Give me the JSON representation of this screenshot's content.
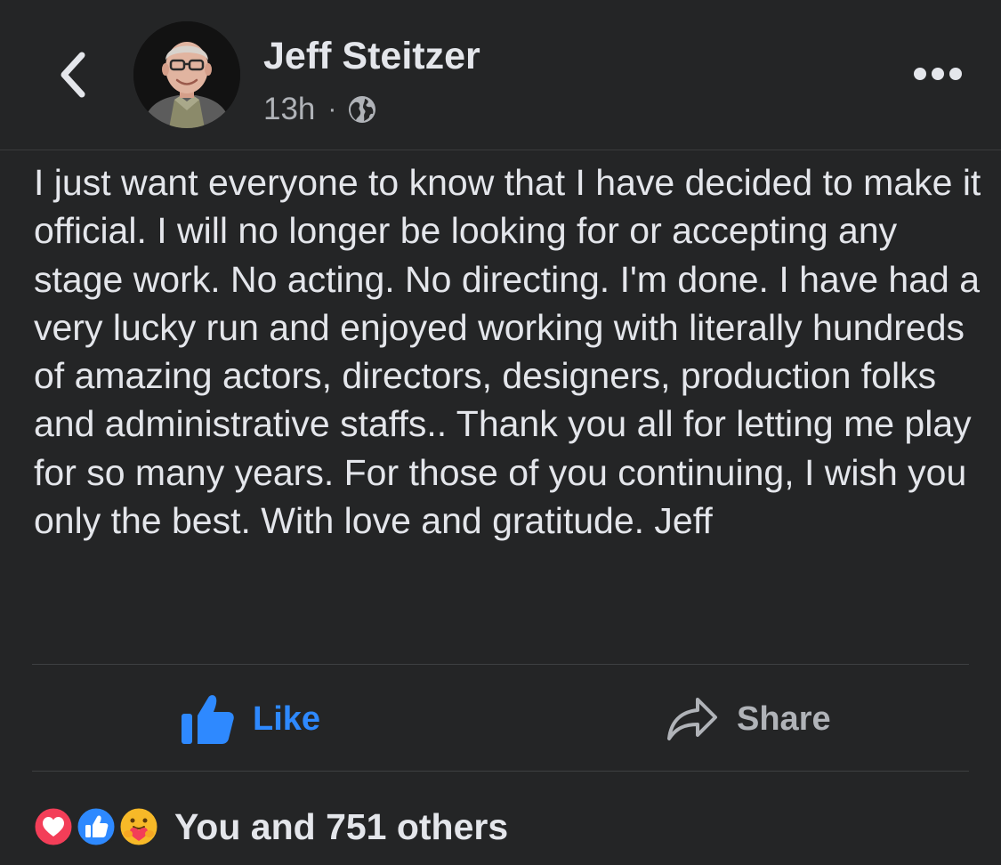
{
  "post": {
    "author_name": "Jeff Steitzer",
    "timestamp": "13h",
    "separator": "·",
    "audience_icon": "globe-icon",
    "text": "I just want everyone to know that I have decided to make it official.  I will no longer be looking for or accepting any stage work.  No acting.  No directing.  I'm done.  I have had a very lucky run and enjoyed working with literally hundreds of amazing actors, directors, designers, production folks and administrative staffs..  Thank you all for letting me play for so many years.  For those of you continuing, I wish you only the best.  With love and gratitude.  Jeff"
  },
  "header": {
    "back_icon": "chevron-left-icon",
    "more_icon": "more-options-icon"
  },
  "actions": {
    "like_label": "Like",
    "like_icon": "thumbs-up-icon",
    "share_label": "Share",
    "share_icon": "share-arrow-icon"
  },
  "reactions": {
    "icons": [
      "love-icon",
      "like-icon",
      "care-icon"
    ],
    "summary": "You and 751 others"
  },
  "colors": {
    "background": "#242526",
    "text_primary": "#e4e6eb",
    "text_secondary": "#b0b3b8",
    "like_blue": "#2e89ff",
    "love_red": "#f33e58",
    "care_yellow": "#f7b928"
  }
}
